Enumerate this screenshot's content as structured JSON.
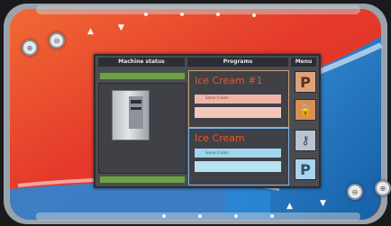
{
  "screen": {
    "headers": {
      "machine_status": "Machine status",
      "programs": "Programs",
      "menu": "Menu"
    },
    "programs": [
      {
        "name": "Ice Cream #1",
        "detail": "Some Cream"
      },
      {
        "name": "Ice Cream",
        "detail": "Some Cream"
      }
    ],
    "menu_buttons": [
      {
        "icon": "parking-p-icon",
        "label": "P"
      },
      {
        "icon": "lock-icon",
        "label": "🔒"
      },
      {
        "icon": "key-icon",
        "label": "⚷"
      },
      {
        "icon": "parking-p-icon",
        "label": "P"
      }
    ]
  },
  "hardware": {
    "left_buttons": [
      "⊕",
      "⊖"
    ],
    "right_buttons": [
      "⊖",
      "⊕"
    ],
    "arrows_top": [
      "▲",
      "▼"
    ],
    "arrows_bottom": [
      "▲",
      "▼"
    ]
  },
  "colors": {
    "panel_red": "#e6332a",
    "panel_blue": "#1f78c8",
    "bezel": "#2a2a2c"
  }
}
